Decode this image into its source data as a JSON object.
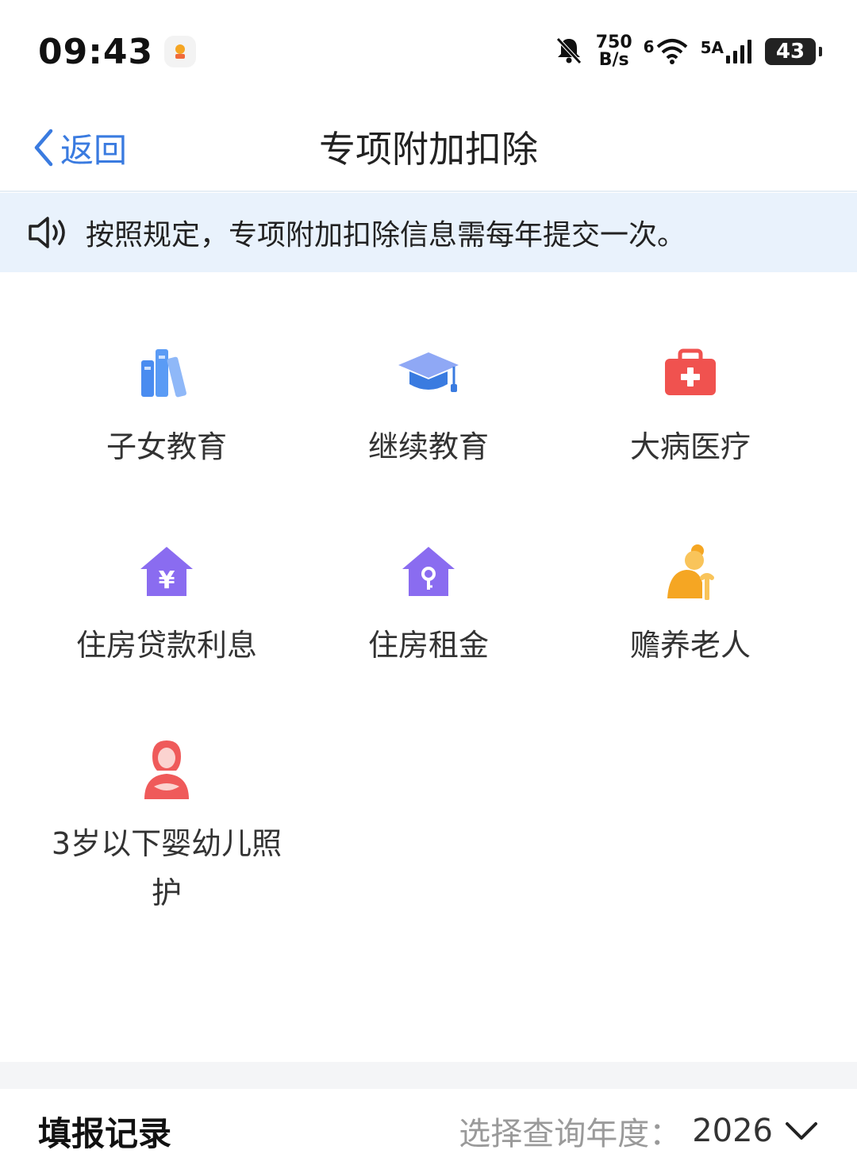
{
  "status_bar": {
    "time": "09:43",
    "net_speed_value": "750",
    "net_speed_unit": "B/s",
    "wifi_label": "6",
    "signal_label": "5A",
    "battery": "43"
  },
  "nav": {
    "back_label": "返回",
    "title": "专项附加扣除"
  },
  "notice": {
    "text": "按照规定，专项附加扣除信息需每年提交一次。"
  },
  "categories": [
    {
      "label": "子女教育",
      "icon": "books-icon"
    },
    {
      "label": "继续教育",
      "icon": "graduation-cap-icon"
    },
    {
      "label": "大病医疗",
      "icon": "medical-kit-icon"
    },
    {
      "label": "住房贷款利息",
      "icon": "house-yuan-icon"
    },
    {
      "label": "住房租金",
      "icon": "house-key-icon"
    },
    {
      "label": "赡养老人",
      "icon": "elderly-person-icon"
    },
    {
      "label": "3岁以下婴幼儿照护",
      "icon": "mother-baby-icon"
    }
  ],
  "records": {
    "title": "填报记录",
    "year_label": "选择查询年度：",
    "year_value": "2026"
  },
  "colors": {
    "accent_blue": "#3a7be0",
    "notice_bg": "#e9f2fc",
    "medical_red": "#f0524f",
    "house_purple": "#8a6cf0",
    "elderly_orange": "#f5a623",
    "mother_red": "#ef5a5a"
  }
}
